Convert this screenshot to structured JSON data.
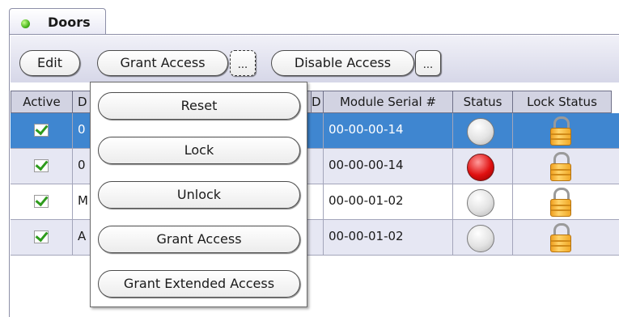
{
  "tab": {
    "label": "Doors",
    "status_color": "#49b51e"
  },
  "toolbar": {
    "edit_label": "Edit",
    "grant_access_label": "Grant Access",
    "more_label": "...",
    "disable_access_label": "Disable Access"
  },
  "grid": {
    "columns": [
      "Active",
      "D",
      "D",
      "Module Serial #",
      "Status",
      "Lock Status"
    ],
    "rows": [
      {
        "active": true,
        "description": "0",
        "module_serial": "00-00-00-14",
        "status": "off",
        "locked": true,
        "selected": true
      },
      {
        "active": true,
        "description": "0",
        "module_serial": "00-00-00-14",
        "status": "red",
        "locked": true,
        "selected": false
      },
      {
        "active": true,
        "description": "M",
        "module_serial": "00-00-01-02",
        "status": "off",
        "locked": true,
        "selected": false
      },
      {
        "active": true,
        "description": "A",
        "module_serial": "00-00-01-02",
        "status": "off",
        "locked": true,
        "selected": false
      }
    ]
  },
  "popup_menu": {
    "items": [
      "Reset",
      "Lock",
      "Unlock",
      "Grant Access",
      "Grant Extended Access"
    ]
  },
  "colors": {
    "selection": "#3f86d0",
    "header": "#d2d3e2",
    "alt_row": "#e6e7f3"
  }
}
